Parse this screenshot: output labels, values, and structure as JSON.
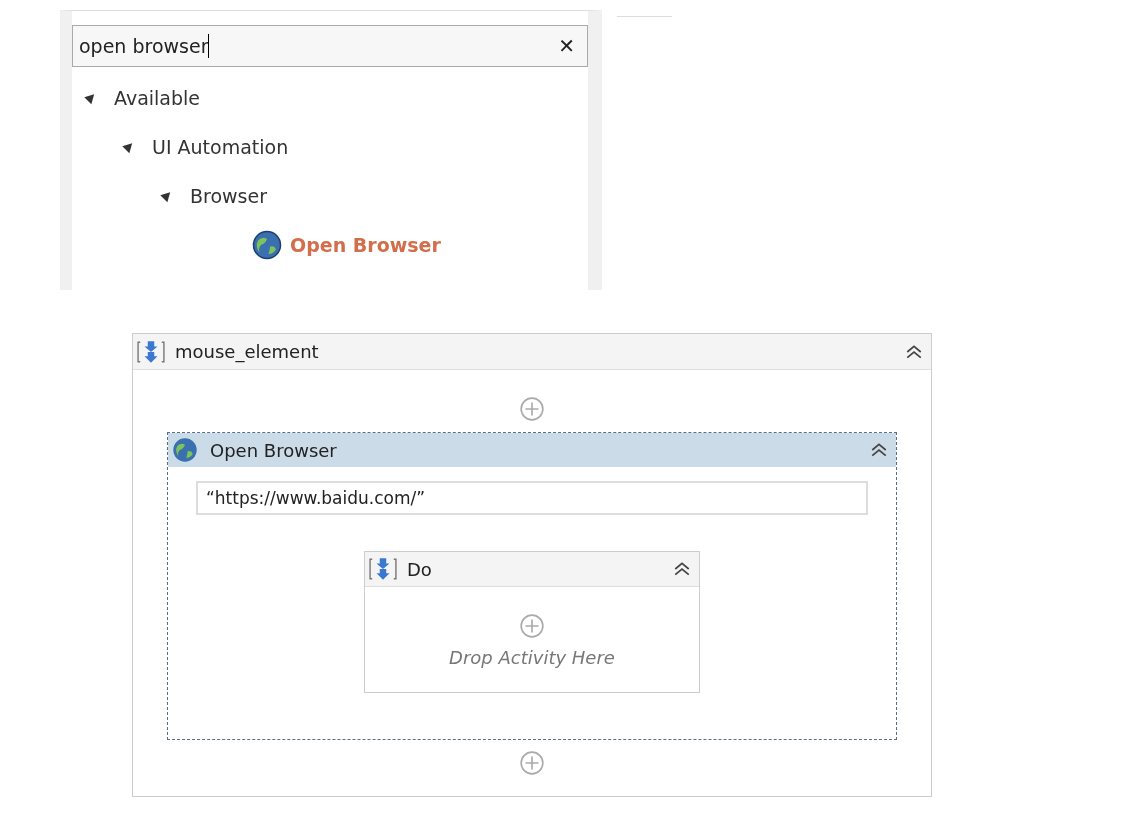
{
  "activities_panel": {
    "search": {
      "value": "open browser",
      "clear": "✕"
    },
    "tree": [
      {
        "label": "Available",
        "expanded": true,
        "children": [
          {
            "label": "UI Automation",
            "expanded": true,
            "children": [
              {
                "label": "Browser",
                "expanded": true,
                "children": [
                  {
                    "label": "Open Browser",
                    "kind": "activity",
                    "matched": true
                  }
                ]
              }
            ]
          }
        ]
      }
    ]
  },
  "workflow": {
    "sequence": {
      "title": "mouse_element",
      "activity": {
        "title": "Open Browser",
        "selected": true,
        "url": "“https://www.baidu.com/”",
        "body": {
          "title": "Do",
          "placeholder": "Drop Activity Here"
        }
      }
    }
  }
}
